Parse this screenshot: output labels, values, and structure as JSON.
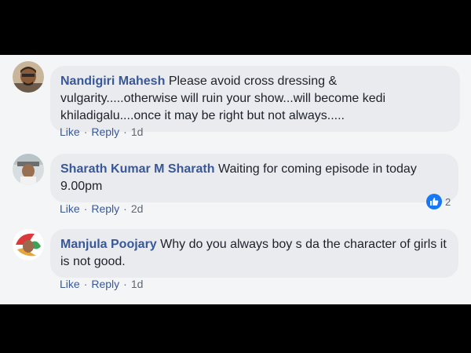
{
  "comments": [
    {
      "author": "Nandigiri Mahesh",
      "text": "Please avoid cross dressing & vulgarity.....otherwise will ruin your show...will become kedi khiladigalu....once it may be right but not always.....",
      "like_label": "Like",
      "reply_label": "Reply",
      "age": "1d"
    },
    {
      "author": "Sharath Kumar M Sharath",
      "text": "Waiting for coming episode in today 9.00pm",
      "like_label": "Like",
      "reply_label": "Reply",
      "age": "2d",
      "reaction": {
        "icon": "thumbs-up-icon",
        "count": "2"
      }
    },
    {
      "author": "Manjula Poojary",
      "text": "Why do you always boy s da the character of girls it is not good.",
      "like_label": "Like",
      "reply_label": "Reply",
      "age": "1d"
    }
  ],
  "separator": "·",
  "colors": {
    "author": "#385898",
    "bubble": "#e9ebee",
    "page": "#f4f5f7",
    "like_badge": "#1877f2"
  }
}
